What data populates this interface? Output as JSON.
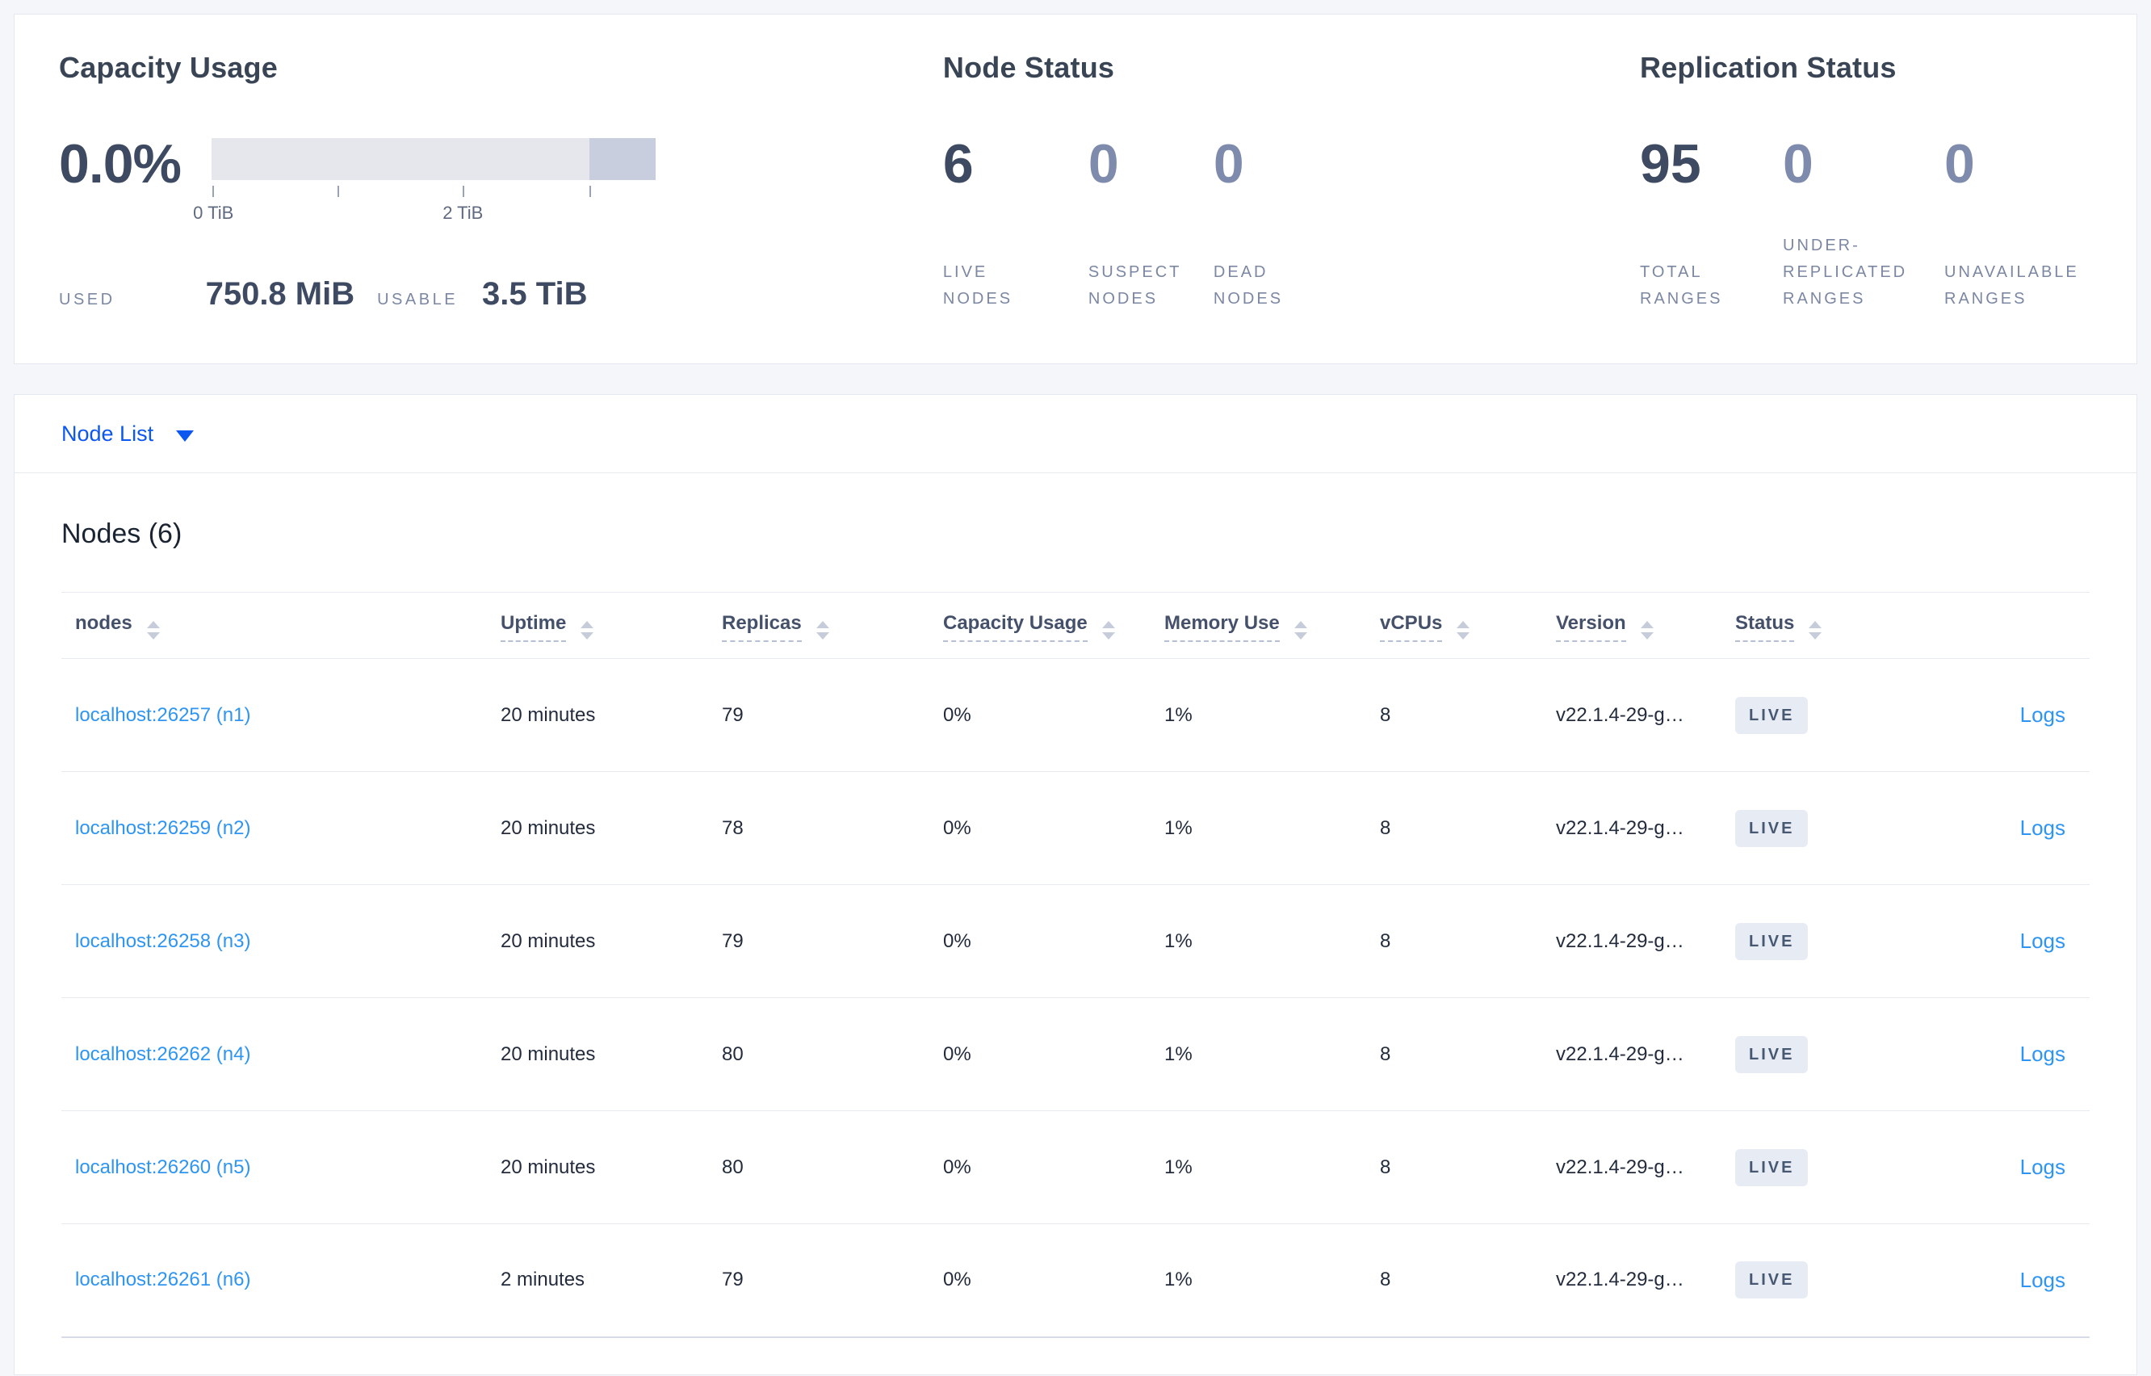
{
  "colors": {
    "page_background": "#f4f6fa",
    "accent_blue": "#0b57f0",
    "link_blue": "#2e95f3",
    "primary_text": "#3e4a61",
    "muted_label": "#7b87a3",
    "badge_background": "#e7ebf3",
    "bar_light": "#e5e7ed",
    "bar_dark": "#c9cede"
  },
  "summary": {
    "capacity": {
      "title": "Capacity Usage",
      "percent": "0.0%",
      "used_label": "USED",
      "used_value": "750.8 MiB",
      "usable_label": "USABLE",
      "usable_value": "3.5 TiB",
      "bar_segments": [
        {
          "name": "capacity",
          "fraction": 0.85,
          "color": "#e5e7ed"
        },
        {
          "name": "other",
          "fraction": 0.15,
          "color": "#c9cede"
        }
      ],
      "axis_ticks": [
        {
          "value": "0 TiB",
          "label": "0 TiB"
        },
        {
          "value": "1 TiB",
          "label": ""
        },
        {
          "value": "2 TiB",
          "label": "2 TiB"
        },
        {
          "value": "3 TiB",
          "label": ""
        }
      ]
    },
    "node_status": {
      "title": "Node Status",
      "stats": [
        {
          "value": "6",
          "label": "LIVE NODES"
        },
        {
          "value": "0",
          "label": "SUSPECT NODES"
        },
        {
          "value": "0",
          "label": "DEAD NODES"
        }
      ]
    },
    "replication_status": {
      "title": "Replication Status",
      "stats": [
        {
          "value": "95",
          "label": "TOTAL RANGES"
        },
        {
          "value": "0",
          "label": "UNDER-REPLICATED RANGES"
        },
        {
          "value": "0",
          "label": "UNAVAILABLE RANGES"
        }
      ]
    }
  },
  "node_list": {
    "label": "Node List"
  },
  "nodes_table": {
    "title": "Nodes (6)",
    "logs_label": "Logs",
    "columns": [
      "nodes",
      "Uptime",
      "Replicas",
      "Capacity Usage",
      "Memory Use",
      "vCPUs",
      "Version",
      "Status"
    ],
    "rows": [
      {
        "node": "localhost:26257 (n1)",
        "uptime": "20 minutes",
        "replicas": "79",
        "capacity": "0%",
        "memory": "1%",
        "vcpus": "8",
        "version": "v22.1.4-29-g…",
        "status": "LIVE"
      },
      {
        "node": "localhost:26259 (n2)",
        "uptime": "20 minutes",
        "replicas": "78",
        "capacity": "0%",
        "memory": "1%",
        "vcpus": "8",
        "version": "v22.1.4-29-g…",
        "status": "LIVE"
      },
      {
        "node": "localhost:26258 (n3)",
        "uptime": "20 minutes",
        "replicas": "79",
        "capacity": "0%",
        "memory": "1%",
        "vcpus": "8",
        "version": "v22.1.4-29-g…",
        "status": "LIVE"
      },
      {
        "node": "localhost:26262 (n4)",
        "uptime": "20 minutes",
        "replicas": "80",
        "capacity": "0%",
        "memory": "1%",
        "vcpus": "8",
        "version": "v22.1.4-29-g…",
        "status": "LIVE"
      },
      {
        "node": "localhost:26260 (n5)",
        "uptime": "20 minutes",
        "replicas": "80",
        "capacity": "0%",
        "memory": "1%",
        "vcpus": "8",
        "version": "v22.1.4-29-g…",
        "status": "LIVE"
      },
      {
        "node": "localhost:26261 (n6)",
        "uptime": "2 minutes",
        "replicas": "79",
        "capacity": "0%",
        "memory": "1%",
        "vcpus": "8",
        "version": "v22.1.4-29-g…",
        "status": "LIVE"
      }
    ]
  }
}
